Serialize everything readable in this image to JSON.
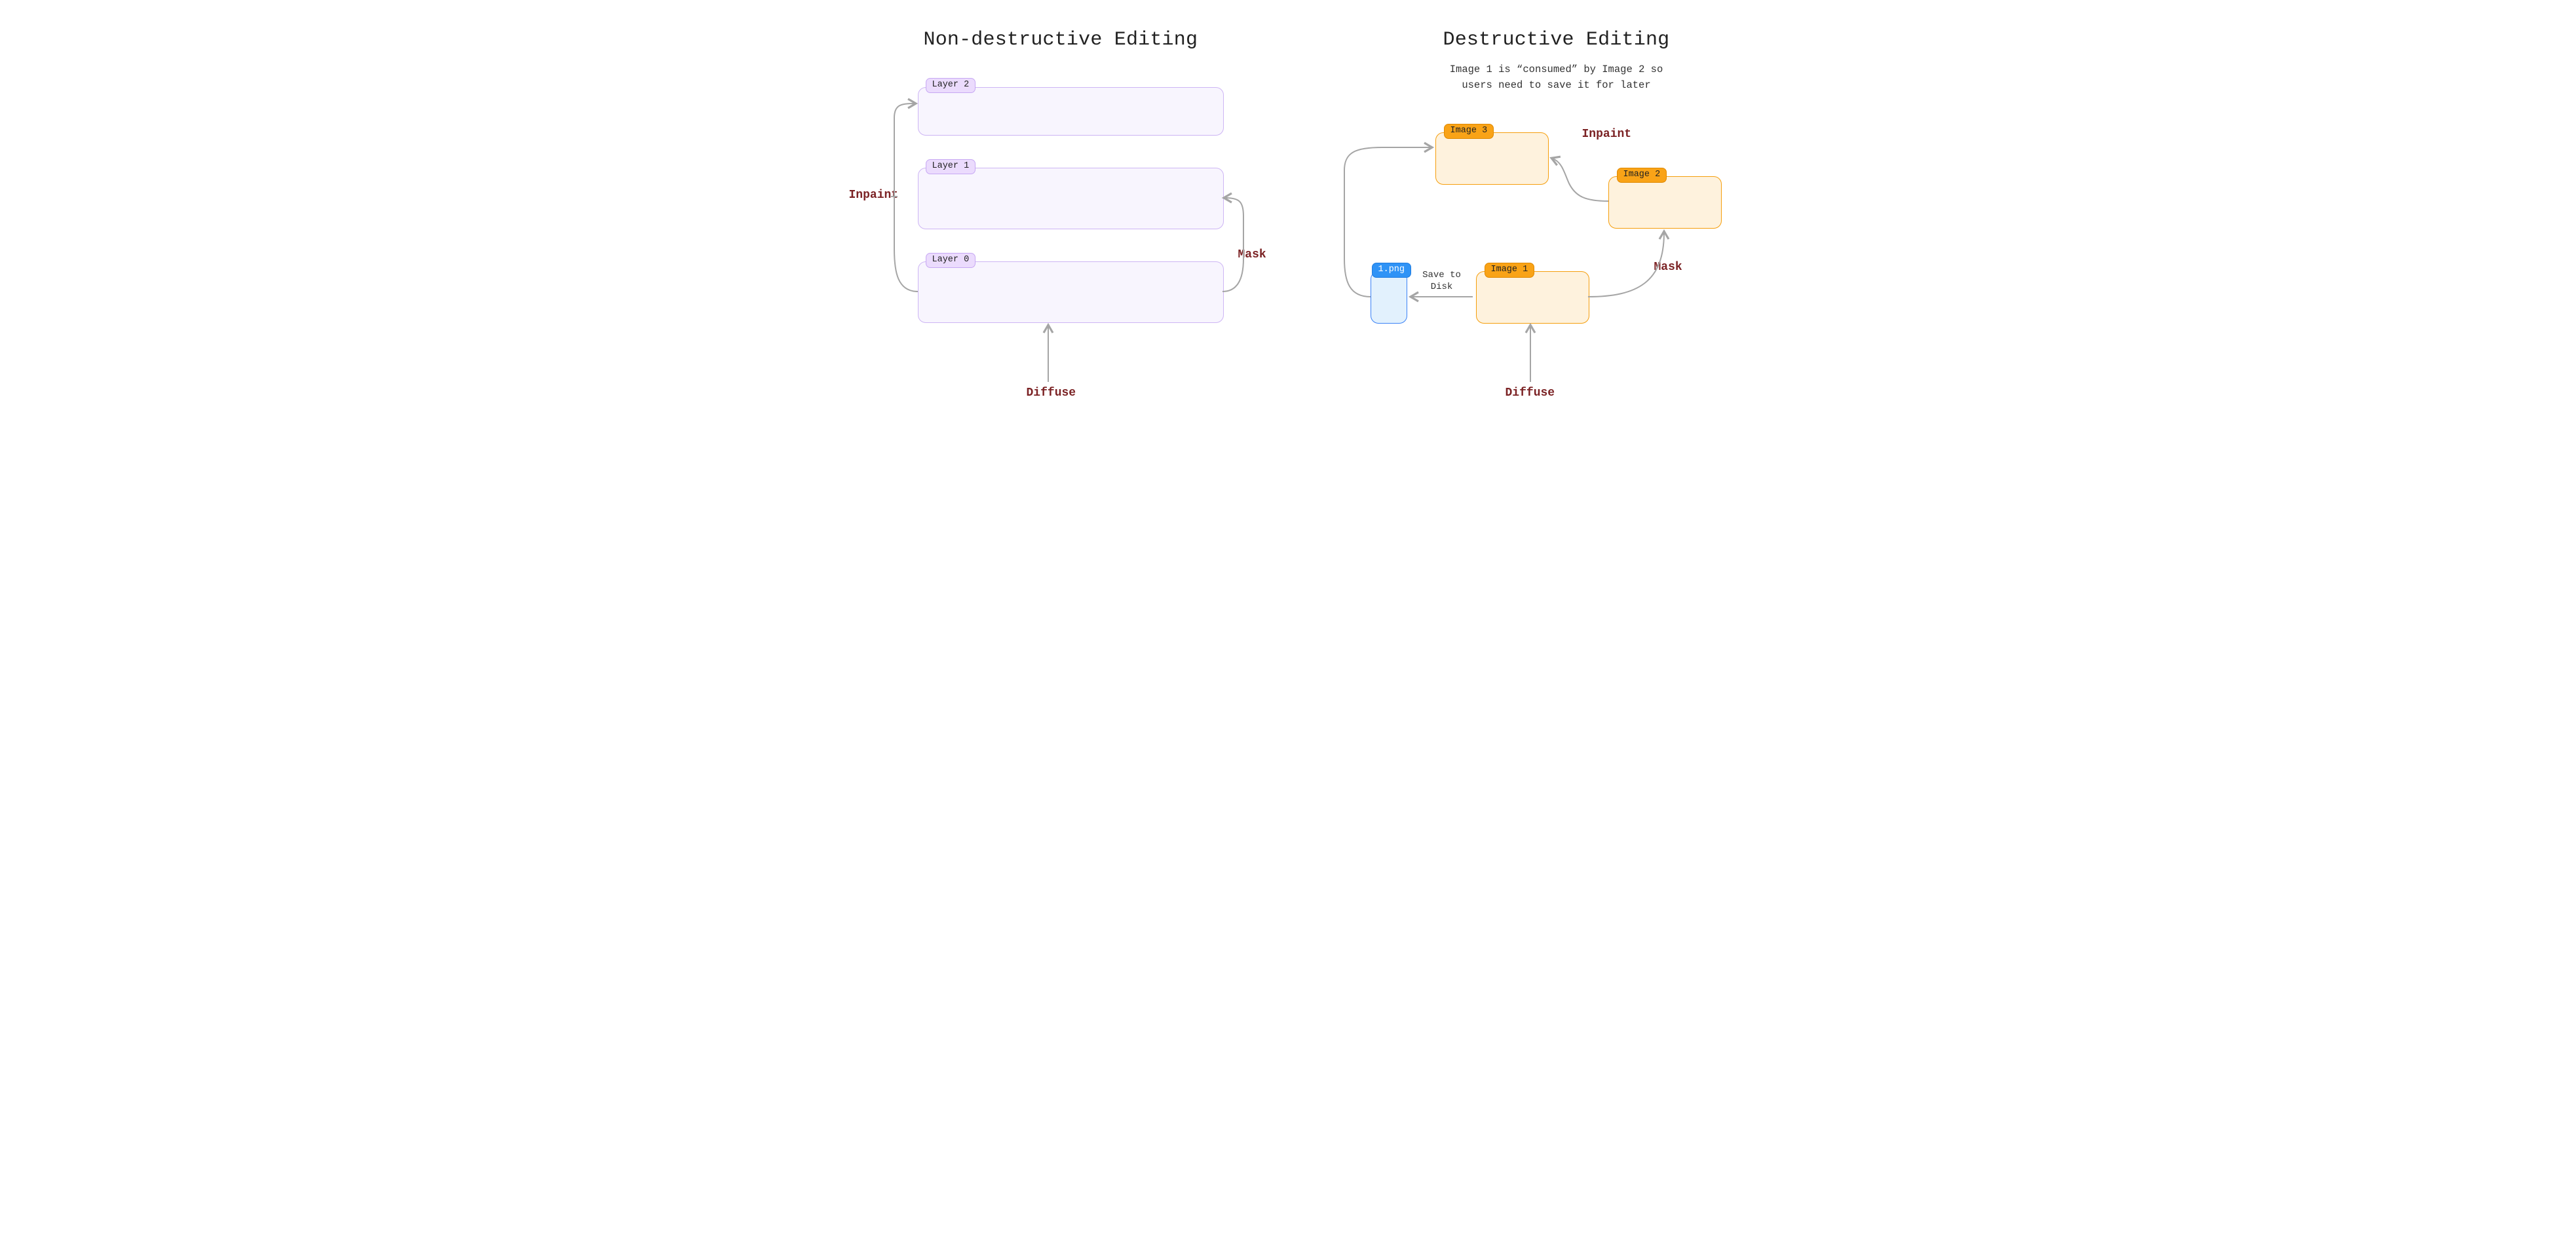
{
  "left": {
    "title": "Non-destructive Editing",
    "layers": [
      "Layer 2",
      "Layer 1",
      "Layer 0"
    ],
    "ops": {
      "inpaint": "Inpaint",
      "mask": "Mask",
      "diffuse": "Diffuse"
    }
  },
  "right": {
    "title": "Destructive Editing",
    "subtitle": "Image 1 is “consumed” by Image 2 so\nusers need to save it for later",
    "images": [
      "Image 3",
      "Image 2",
      "Image 1"
    ],
    "file": "1.png",
    "save_label": "Save to\nDisk",
    "ops": {
      "inpaint": "Inpaint",
      "mask": "Mask",
      "diffuse": "Diffuse"
    }
  },
  "colors": {
    "arrow": "#a5a5a5",
    "maroon": "#7b2224",
    "purple_fill": "#f8f5fe",
    "purple_stroke": "#cdb5f4",
    "orange_fill": "#fef2dd",
    "orange_stroke": "#f59e0c",
    "blue_fill": "#e2f1fd",
    "blue_stroke": "#3b82f6"
  }
}
